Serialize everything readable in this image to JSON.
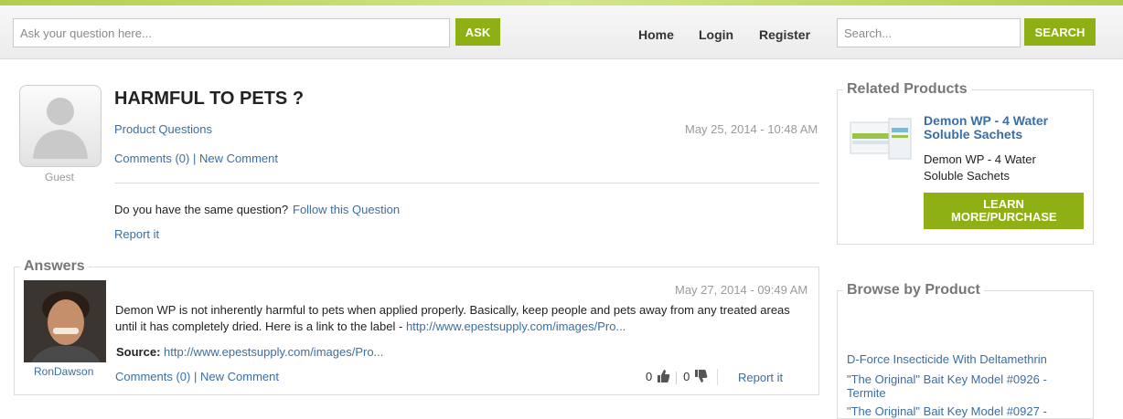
{
  "header": {
    "ask_placeholder": "Ask your question here...",
    "ask_button": "ASK",
    "nav": [
      "Home",
      "Login",
      "Register"
    ],
    "search_placeholder": "Search...",
    "search_button": "SEARCH"
  },
  "question": {
    "avatar_label": "Guest",
    "title": "HARMFUL TO PETS ?",
    "category": "Product Questions",
    "date": "May 25, 2014 - 10:48 AM",
    "comments_link": "Comments (0)",
    "separator": "|",
    "new_comment": "New Comment",
    "same_question": "Do you have the same question?",
    "follow_link": "Follow this Question",
    "report": "Report it"
  },
  "answers": {
    "legend": "Answers",
    "items": [
      {
        "author": "RonDawson",
        "date": "May 27, 2014 - 09:49 AM",
        "text": "Demon WP is not inherently harmful to pets when applied properly. Basically, keep people and pets away from any treated areas until it has completely dried. Here is a link to the label - ",
        "text_link": "http://www.epestsupply.com/images/Pro...",
        "source_label": "Source:",
        "source_link": "http://www.epestsupply.com/images/Pro...",
        "comments_link": "Comments (0)",
        "separator": "|",
        "new_comment": "New Comment",
        "upvotes": "0",
        "downvotes": "0",
        "report": "Report it"
      }
    ]
  },
  "related": {
    "legend": "Related Products",
    "product_title": "Demon WP - 4 Water Soluble Sachets",
    "product_desc": "Demon WP - 4 Water Soluble Sachets",
    "cta": "LEARN MORE/PURCHASE"
  },
  "browse": {
    "legend": "Browse by Product",
    "items": [
      "D-Force Insecticide With Deltamethrin",
      "\"The Original\" Bait Key Model #0926 - Termite",
      "\"The Original\" Bait Key Model #0927 -"
    ]
  },
  "icons": [
    "user-silhouette-icon",
    "thumbs-up-icon",
    "thumbs-down-icon"
  ],
  "colors": {
    "accent": "#8fb014",
    "link": "#3a6ea5",
    "stripe": "#b3cd4a"
  }
}
